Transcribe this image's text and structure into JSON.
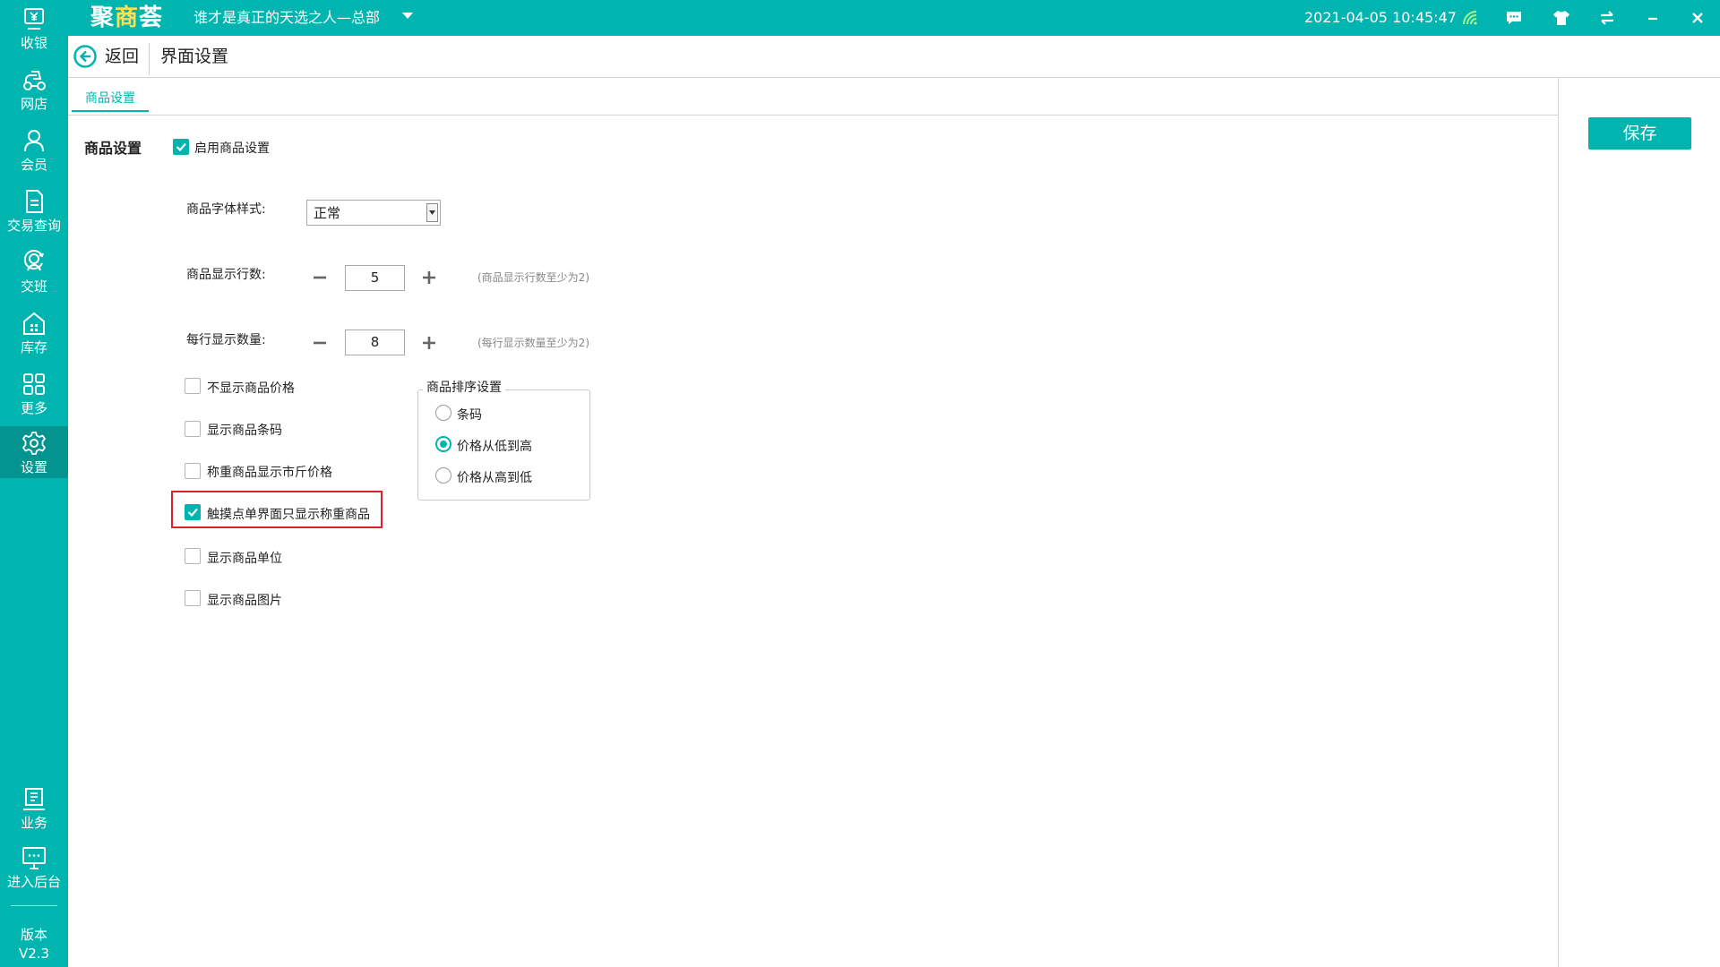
{
  "app": {
    "logo_text_a": "聚",
    "logo_text_b": "商",
    "logo_text_c": "荟",
    "store_name": "谁才是真正的天选之人—总部",
    "datetime": "2021-04-05 10:45:47",
    "accent_color": "#00b5b0",
    "icons": [
      "wifi-icon",
      "message-icon",
      "shirt-icon",
      "sync-icon",
      "minimize-icon",
      "close-icon"
    ]
  },
  "sidebar": {
    "items": [
      {
        "label": "收银",
        "icon": "cashier-icon"
      },
      {
        "label": "网店",
        "icon": "online-store-icon"
      },
      {
        "label": "会员",
        "icon": "member-icon"
      },
      {
        "label": "交易查询",
        "icon": "transaction-icon"
      },
      {
        "label": "交班",
        "icon": "shift-icon"
      },
      {
        "label": "库存",
        "icon": "inventory-icon"
      },
      {
        "label": "更多",
        "icon": "more-icon"
      },
      {
        "label": "设置",
        "icon": "settings-icon",
        "active": true
      },
      {
        "label": "业务",
        "icon": "business-icon"
      },
      {
        "label": "进入后台",
        "icon": "backend-icon"
      }
    ],
    "version_label": "版本",
    "version_value": "V2.3"
  },
  "header": {
    "back_label": "返回",
    "title": "界面设置"
  },
  "tabs": [
    {
      "label": "商品设置",
      "active": true
    }
  ],
  "save_label": "保存",
  "form": {
    "section_title": "商品设置",
    "enable": {
      "label": "启用商品设置",
      "checked": true
    },
    "font_style": {
      "label": "商品字体样式:",
      "value": "正常"
    },
    "rows": {
      "label": "商品显示行数:",
      "value": "5",
      "hint": "(商品显示行数至少为2)"
    },
    "per_row": {
      "label": "每行显示数量:",
      "value": "8",
      "hint": "(每行显示数量至少为2)"
    },
    "options": [
      {
        "label": "不显示商品价格",
        "checked": false
      },
      {
        "label": "显示商品条码",
        "checked": false
      },
      {
        "label": "称重商品显示市斤价格",
        "checked": false
      },
      {
        "label": "触摸点单界面只显示称重商品",
        "checked": true
      },
      {
        "label": "显示商品单位",
        "checked": false
      },
      {
        "label": "显示商品图片",
        "checked": false
      }
    ],
    "sort": {
      "title": "商品排序设置",
      "options": [
        {
          "label": "条码",
          "selected": false
        },
        {
          "label": "价格从低到高",
          "selected": true
        },
        {
          "label": "价格从高到低",
          "selected": false
        }
      ]
    }
  }
}
